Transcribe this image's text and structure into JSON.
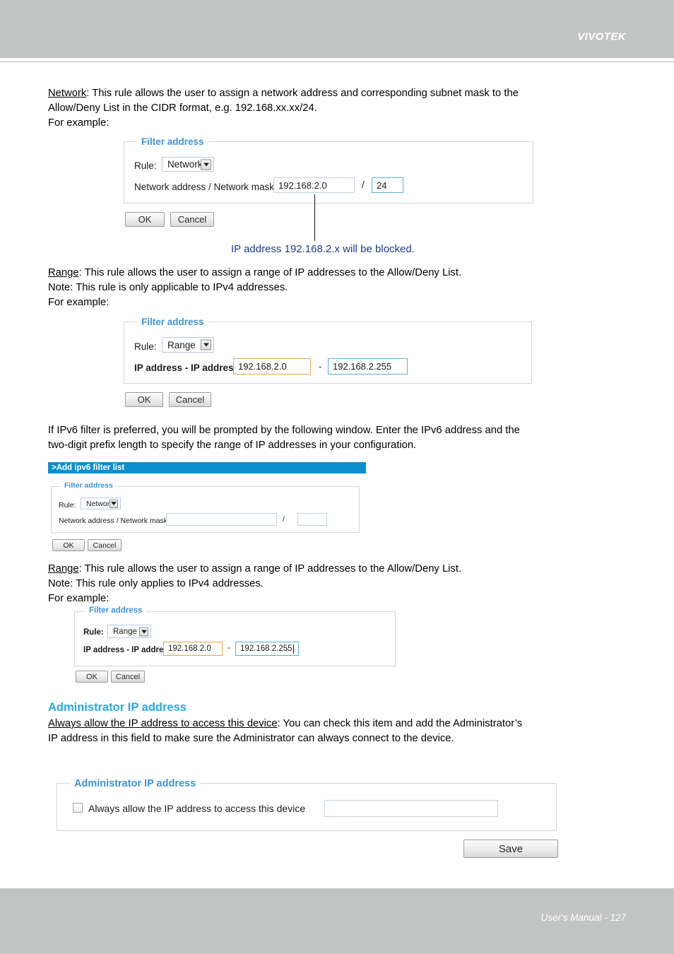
{
  "header": {
    "brand": "VIVOTEK"
  },
  "footer": {
    "folio": "User's Manual - 127"
  },
  "body": {
    "p1_line1": "Network: This rule allows the user to assign a network address and corresponding subnet mask to the",
    "p1_line2": "Allow/Deny List in the CIDR format, e.g. 192.168.xx.xx/24.",
    "p1_line3": "For example:",
    "p1_term": "Network",
    "p1_rest1": ": This rule allows the user to assign a network address and corresponding subnet mask to the",
    "callout1": "IP address 192.168.2.x will be blocked.",
    "p2_term": "Range",
    "p2_line1": ": This rule allows the user to assign a range of IP addresses to the Allow/Deny List.",
    "p2_line2": "Note: This rule is only applicable to IPv4 addresses.",
    "p2_line3": "For example:",
    "p3_line1": "If IPv6 filter is preferred, you will be prompted by the following window. Enter the IPv6 address and the",
    "p3_line2": "two-digit prefix length to specify the range of IP addresses in your configuration.",
    "p4_term": "Range",
    "p4_line1": ": This rule allows the user to assign a range of IP addresses to the Allow/Deny List.",
    "p4_line2": "Note: This rule only applies to IPv4 addresses.",
    "p4_line3": "For example:",
    "admin_heading": "Administrator IP address",
    "p5_term": "Always allow the IP address to access this device",
    "p5_line1": ": You can check this item and add the Administrator’s",
    "p5_line2": "IP address in this field to make sure the Administrator can always connect to the device."
  },
  "dialog_network_v4": {
    "legend": "Filter address",
    "rule_label": "Rule:",
    "rule_value": "Network",
    "field_label": "Network address / Network mask:",
    "address_value": "192.168.2.0",
    "separator": "/",
    "mask_value": "24",
    "ok_label": "OK",
    "cancel_label": "Cancel"
  },
  "dialog_range_v4": {
    "legend": "Filter address",
    "rule_label": "Rule:",
    "rule_value": "Range",
    "field_label": "IP address - IP address:",
    "start_value": "192.168.2.0",
    "separator": "-",
    "end_value": "192.168.2.255",
    "ok_label": "OK",
    "cancel_label": "Cancel"
  },
  "dialog_ipv6": {
    "window_title": ">Add ipv6 filter list",
    "legend": "Filter address",
    "rule_label": "Rule:",
    "rule_value": "Network",
    "field_label": "Network address / Network mask:",
    "address_value": "",
    "separator": "/",
    "mask_value": "",
    "ok_label": "OK",
    "cancel_label": "Cancel"
  },
  "dialog_range_v4_small": {
    "legend": "Filter address",
    "rule_label": "Rule:",
    "rule_value": "Range",
    "field_label": "IP address - IP address:",
    "start_value": "192.168.2.0",
    "separator": "-",
    "end_value": "192.168.2.255",
    "ok_label": "OK",
    "cancel_label": "Cancel"
  },
  "admin_panel": {
    "legend": "Administrator IP address",
    "checkbox_label": "Always allow the IP address to access this device",
    "checkbox_checked": false,
    "ip_value": "",
    "save_label": "Save"
  },
  "colors": {
    "page_chrome": "#c3c5c4",
    "legend_blue": "#3f93d4",
    "heading_blue": "#2aa8e0",
    "callout_blue": "#1f3b93",
    "titlebar_blue": "#0d8ecf",
    "input_focus_blue": "#5aaee0",
    "input_warn_orange": "#e8a24c"
  }
}
